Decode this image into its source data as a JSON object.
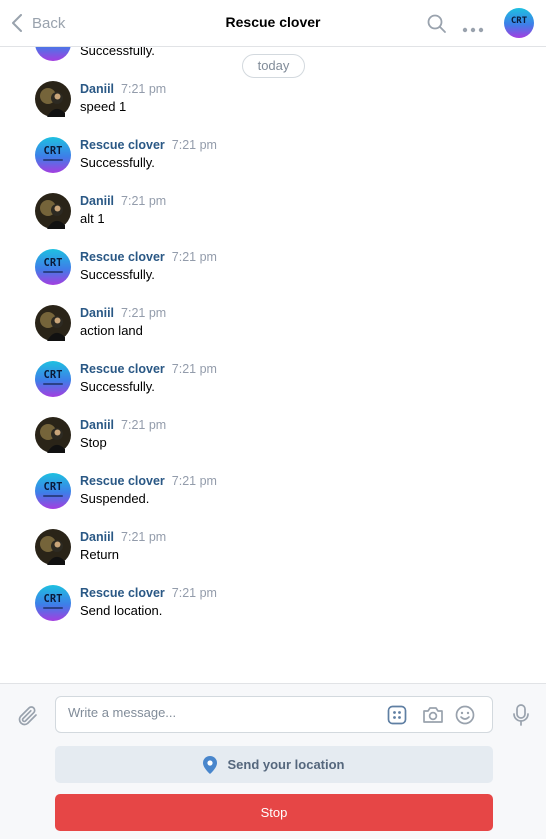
{
  "header": {
    "back_label": "Back",
    "title": "Rescue clover",
    "icons": [
      "search-icon",
      "more-icon",
      "avatar"
    ]
  },
  "chat": {
    "date_divider": "today",
    "partial_message_text": "Successfully.",
    "messages": [
      {
        "author": "Daniil",
        "time": "7:21 pm",
        "text": "speed 1",
        "avatar_label": ""
      },
      {
        "author": "Rescue clover",
        "time": "7:21 pm",
        "text": "Successfully.",
        "avatar_label": "CRT"
      },
      {
        "author": "Daniil",
        "time": "7:21 pm",
        "text": "alt 1",
        "avatar_label": ""
      },
      {
        "author": "Rescue clover",
        "time": "7:21 pm",
        "text": "Successfully.",
        "avatar_label": "CRT"
      },
      {
        "author": "Daniil",
        "time": "7:21 pm",
        "text": "action land",
        "avatar_label": ""
      },
      {
        "author": "Rescue clover",
        "time": "7:21 pm",
        "text": "Successfully.",
        "avatar_label": "CRT"
      },
      {
        "author": "Daniil",
        "time": "7:21 pm",
        "text": "Stop",
        "avatar_label": ""
      },
      {
        "author": "Rescue clover",
        "time": "7:21 pm",
        "text": "Suspended.",
        "avatar_label": "CRT"
      },
      {
        "author": "Daniil",
        "time": "7:21 pm",
        "text": "Return",
        "avatar_label": ""
      },
      {
        "author": "Rescue clover",
        "time": "7:21 pm",
        "text": "Send location.",
        "avatar_label": "CRT"
      }
    ]
  },
  "composer": {
    "placeholder": "Write a message...",
    "send_location_label": "Send your location",
    "stop_label": "Stop",
    "icons": [
      "paperclip-icon",
      "keyboard-icon",
      "camera-icon",
      "emoji-icon",
      "microphone-icon",
      "location-pin-icon"
    ]
  },
  "colors": {
    "author_name": "#2a5885",
    "stop_button": "#e64646",
    "location_button_bg": "#e5ebf1",
    "location_pin": "#4986cc"
  }
}
